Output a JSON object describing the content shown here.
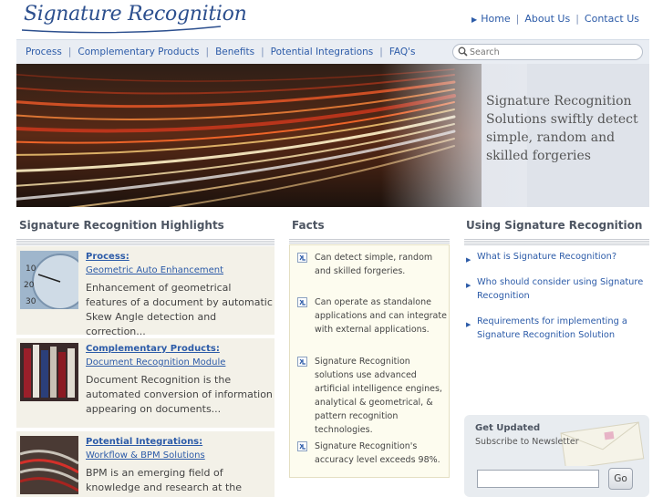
{
  "logo": {
    "text": "Signature Recognition"
  },
  "top_links": [
    "Home",
    "About Us",
    "Contact Us"
  ],
  "nav": [
    "Process",
    "Complementary Products",
    "Benefits",
    "Potential Integrations",
    "FAQ's"
  ],
  "search": {
    "placeholder": "Search"
  },
  "hero": {
    "text": "Signature Recognition Solutions swiftly detect simple, random and skilled forgeries"
  },
  "highlights": {
    "heading": "Signature Recognition Highlights",
    "items": [
      {
        "title": "Process:",
        "subtitle": "Geometric Auto Enhancement",
        "desc": "Enhancement of geometrical features of a document by automatic Skew Angle detection and correction..."
      },
      {
        "title": "Complementary Products:",
        "subtitle": "Document Recognition Module",
        "desc": "Document Recognition is the automated conversion of information appearing on documents..."
      },
      {
        "title": "Potential Integrations:",
        "subtitle": "Workflow & BPM Solutions",
        "desc": "BPM is an emerging field of knowledge and research at the intersection"
      }
    ]
  },
  "facts": {
    "heading": "Facts",
    "items": [
      "Can detect simple, random and skilled forgeries.",
      "Can operate as standalone applications and can integrate with external applications.",
      "Signature Recognition solutions use advanced artificial intelligence engines, analytical & geometrical, & pattern recognition technologies.",
      "Signature Recognition's accuracy level exceeds 98%."
    ]
  },
  "using": {
    "heading": "Using Signature Recognition",
    "items": [
      "What is Signature Recognition?",
      "Who should consider using Signature Recognition",
      "Requirements for implementing a Signature Recognition Solution"
    ]
  },
  "newsletter": {
    "title": "Get Updated",
    "subtitle": "Subscribe to Newsletter",
    "input_value": "",
    "button": "Go"
  },
  "colors": {
    "link": "#2c5ba8",
    "heading": "#4d5562",
    "nav_bg": "#e9edf3",
    "facts_bg": "#fdfcef",
    "highlight_bg": "#f3f1e8"
  },
  "icons": [
    "search-icon",
    "fact-bullet-icon",
    "arrow-icon",
    "envelope-icon"
  ]
}
